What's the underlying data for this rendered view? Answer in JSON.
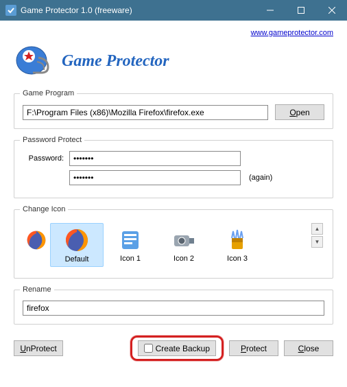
{
  "window": {
    "title": "Game Protector 1.0 (freeware)"
  },
  "header": {
    "url_text": "www.gameprotector.com",
    "app_name": "Game Protector"
  },
  "game_program": {
    "legend": "Game Program",
    "path": "F:\\Program Files (x86)\\Mozilla Firefox\\firefox.exe",
    "open_btn": "Open"
  },
  "password_protect": {
    "legend": "Password Protect",
    "label": "Password:",
    "value1": "•••••••",
    "value2": "•••••••",
    "again": "(again)"
  },
  "change_icon": {
    "legend": "Change Icon",
    "items": [
      {
        "label": ""
      },
      {
        "label": "Default"
      },
      {
        "label": "Icon 1"
      },
      {
        "label": "Icon 2"
      },
      {
        "label": "Icon 3"
      }
    ]
  },
  "rename": {
    "legend": "Rename",
    "value": "firefox"
  },
  "footer": {
    "unprotect": "UnProtect",
    "create_backup": "Create Backup",
    "protect": "Protect",
    "close": "Close"
  }
}
